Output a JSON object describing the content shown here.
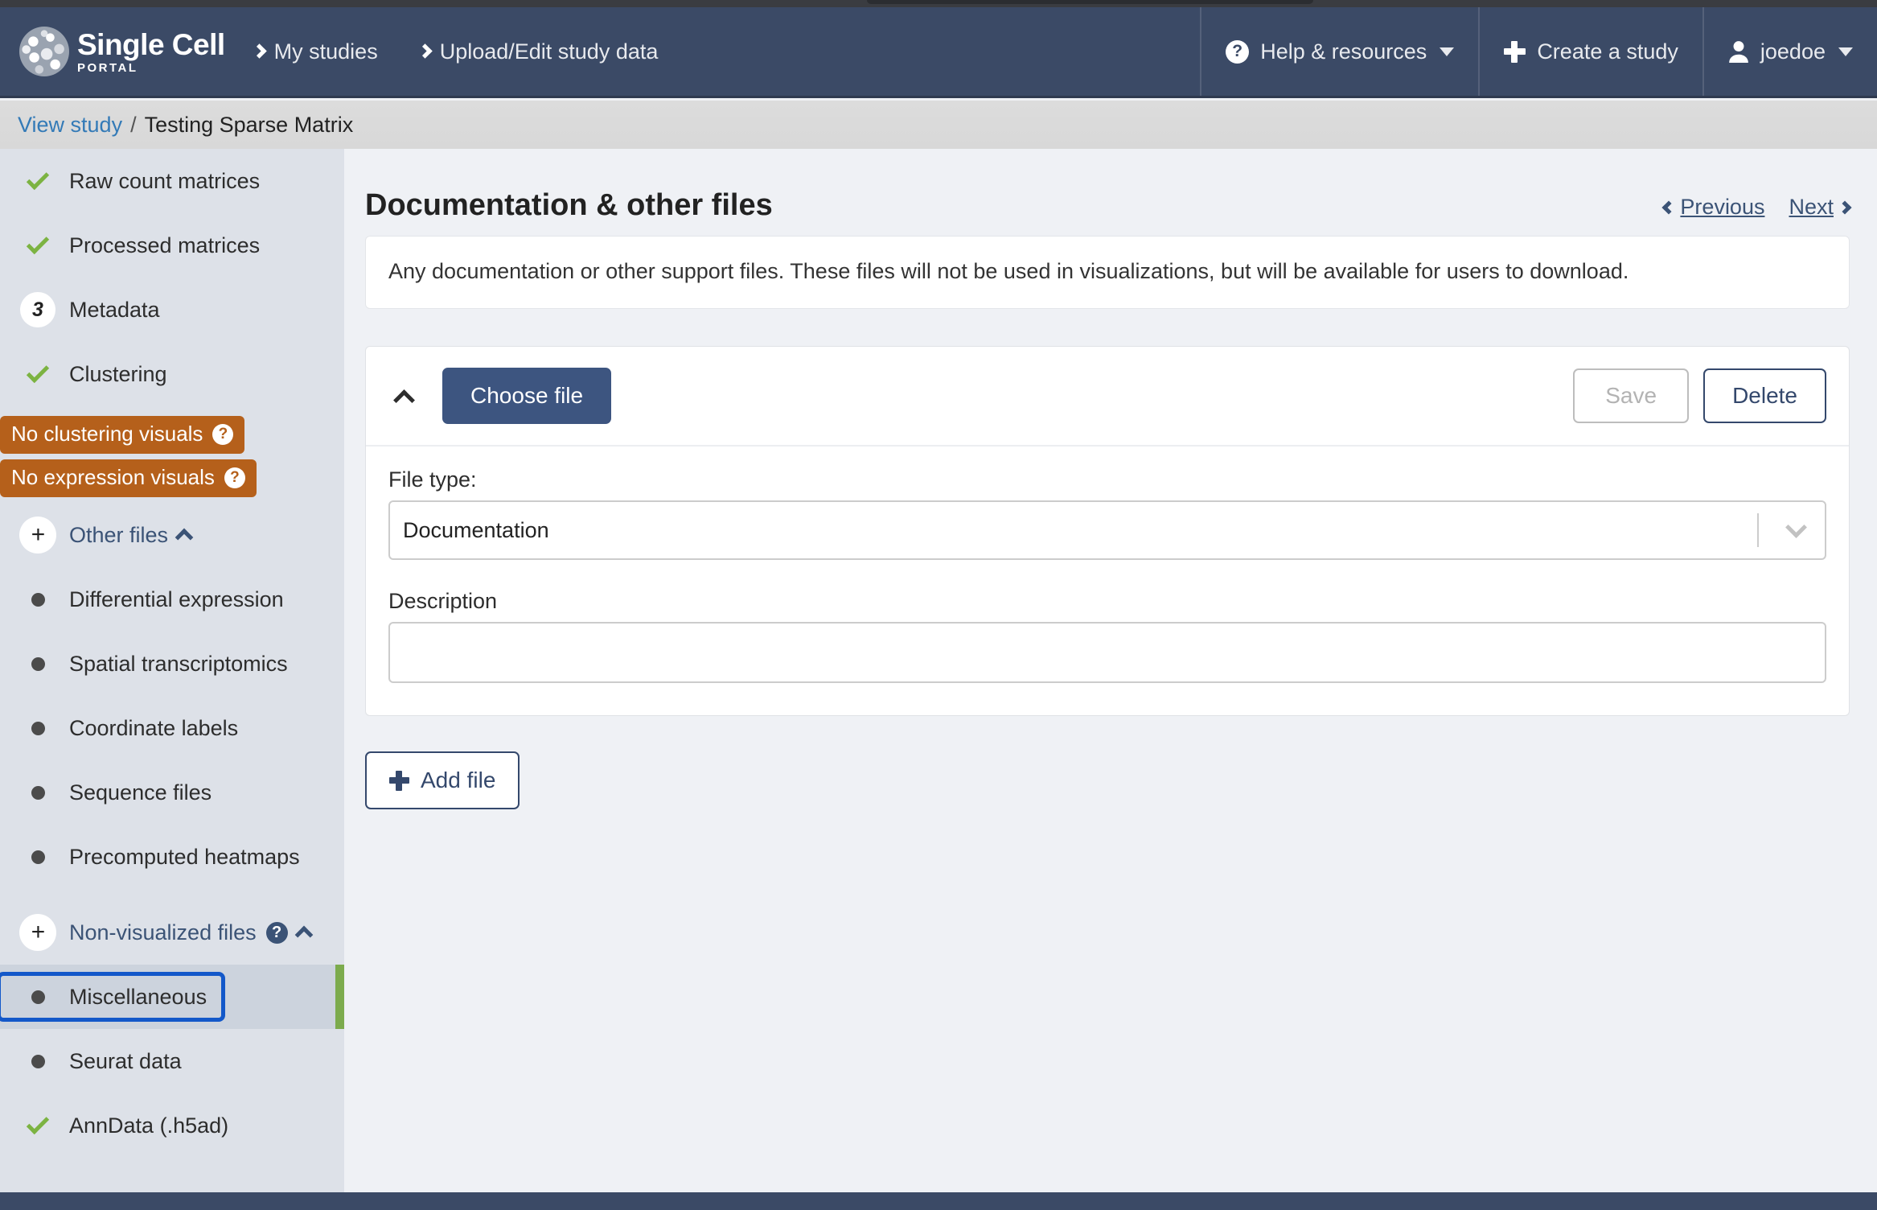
{
  "navbar": {
    "brand_title": "Single Cell",
    "brand_sub": "PORTAL",
    "links": [
      {
        "label": "My studies",
        "icon": "chevron-right-icon"
      },
      {
        "label": "Upload/Edit study data",
        "icon": "chevron-right-icon"
      }
    ],
    "help": {
      "label": "Help & resources",
      "icon": "question-circle-icon",
      "caret": "caret-down-icon"
    },
    "create": {
      "label": "Create a study",
      "icon": "plus-icon"
    },
    "user": {
      "label": "joedoe",
      "icon": "user-icon",
      "caret": "caret-down-icon"
    }
  },
  "breadcrumb": {
    "link": "View study",
    "separator": "/",
    "current": "Testing Sparse Matrix"
  },
  "sidebar": {
    "items": [
      {
        "label": "Raw count matrices",
        "status": "check"
      },
      {
        "label": "Processed matrices",
        "status": "check"
      },
      {
        "label": "Metadata",
        "status": "count",
        "count": "3"
      },
      {
        "label": "Clustering",
        "status": "check"
      }
    ],
    "badges": [
      {
        "label": "No clustering visuals",
        "icon": "question-circle-icon"
      },
      {
        "label": "No expression visuals",
        "icon": "question-circle-icon"
      }
    ],
    "other_files": {
      "label": "Other files",
      "add_icon": "plus-circle-icon",
      "collapse_icon": "chevron-up-icon",
      "children": [
        {
          "label": "Differential expression",
          "status": "dot"
        },
        {
          "label": "Spatial transcriptomics",
          "status": "dot"
        },
        {
          "label": "Coordinate labels",
          "status": "dot"
        },
        {
          "label": "Sequence files",
          "status": "dot"
        },
        {
          "label": "Precomputed heatmaps",
          "status": "dot"
        }
      ]
    },
    "non_visualized": {
      "label": "Non-visualized files",
      "add_icon": "plus-circle-icon",
      "help_icon": "question-circle-icon",
      "collapse_icon": "chevron-up-icon",
      "children": [
        {
          "label": "Miscellaneous",
          "status": "dot",
          "selected": true
        },
        {
          "label": "Seurat data",
          "status": "dot",
          "selected": false
        },
        {
          "label": "AnnData (.h5ad)",
          "status": "check",
          "selected": false
        }
      ]
    }
  },
  "main": {
    "title": "Documentation & other files",
    "pager": {
      "previous": "Previous",
      "next": "Next",
      "prev_icon": "chevron-left-icon",
      "next_icon": "chevron-right-icon"
    },
    "info_text": "Any documentation or other support files. These files will not be used in visualizations, but will be available for users to download.",
    "file_card": {
      "collapse_icon": "chevron-up-icon",
      "choose_file_label": "Choose file",
      "save_label": "Save",
      "delete_label": "Delete",
      "file_type_label": "File type:",
      "file_type_value": "Documentation",
      "file_type_chevron": "chevron-down-icon",
      "description_label": "Description",
      "description_value": "",
      "description_placeholder": ""
    },
    "add_file_label": "Add file",
    "add_file_icon": "plus-icon"
  },
  "colors": {
    "navy": "#3b4a66",
    "accent_blue": "#34486c",
    "warning_orange": "#b5601b",
    "success_green": "#7cb342",
    "focus_blue": "#1358c9",
    "link_blue": "#337ab7"
  }
}
